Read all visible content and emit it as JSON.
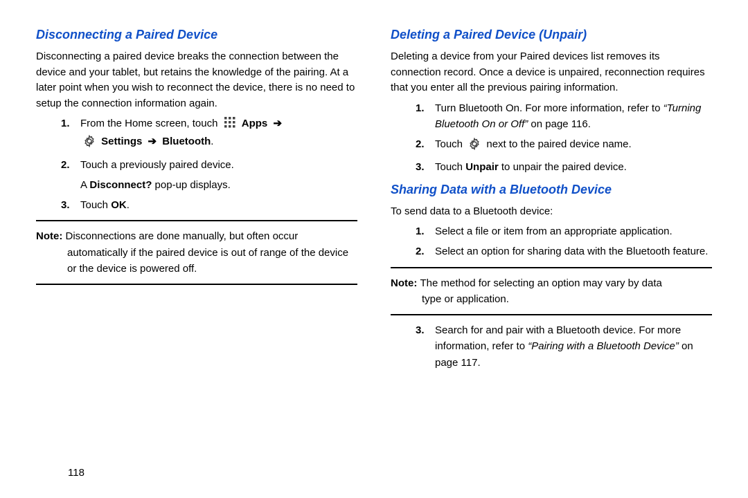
{
  "page_number": "118",
  "left": {
    "heading": "Disconnecting a Paired Device",
    "intro": "Disconnecting a paired device breaks the connection between the device and your tablet, but retains the knowledge of the pairing. At a later point when you wish to reconnect the device, there is no need to setup the connection information again.",
    "steps": {
      "s1": {
        "n": "1.",
        "pre": "From the Home screen, touch",
        "apps": "Apps",
        "arrow": "➔",
        "settings": "Settings",
        "bt": "Bluetooth"
      },
      "s2": {
        "n": "2.",
        "t": "Touch a previously paired device."
      },
      "s2sub_a": "A ",
      "s2sub_b": "Disconnect?",
      "s2sub_c": " pop-up displays.",
      "s3": {
        "n": "3.",
        "pre": "Touch ",
        "ok": "OK",
        "post": "."
      }
    },
    "note_label": "Note: ",
    "note_text_1": "Disconnections are done manually, but often occur",
    "note_text_2": "automatically if the paired device is out of range of the device or the device is powered off."
  },
  "right": {
    "heading1": "Deleting a Paired Device (Unpair)",
    "intro1": "Deleting a device from your Paired devices list removes its connection record. Once a device is unpaired, reconnection requires that you enter all the previous pairing information.",
    "steps1": {
      "s1": {
        "n": "1.",
        "pre": "Turn Bluetooth On. For more information, refer to ",
        "ref": "“Turning Bluetooth On or Off”",
        "post": "  on page 116."
      },
      "s2": {
        "n": "2.",
        "pre": "Touch ",
        "post": " next to the paired device name."
      },
      "s3": {
        "n": "3.",
        "pre": "Touch ",
        "unpair": "Unpair",
        "post": " to unpair the paired device."
      }
    },
    "heading2": "Sharing Data with a Bluetooth Device",
    "intro2": "To send data to a Bluetooth device:",
    "steps2a": {
      "s1": {
        "n": "1.",
        "t": "Select a file or item from an appropriate application."
      },
      "s2": {
        "n": "2.",
        "t": "Select an option for sharing data with the Bluetooth feature."
      }
    },
    "note_label": "Note: ",
    "note_text_1": "The method for selecting an option may vary by data",
    "note_text_2": "type or application.",
    "steps2b": {
      "s3": {
        "n": "3.",
        "pre": "Search for and pair with a Bluetooth device. For more information, refer to ",
        "ref": "“Pairing with a Bluetooth Device”",
        "post": " on page 117."
      }
    }
  }
}
